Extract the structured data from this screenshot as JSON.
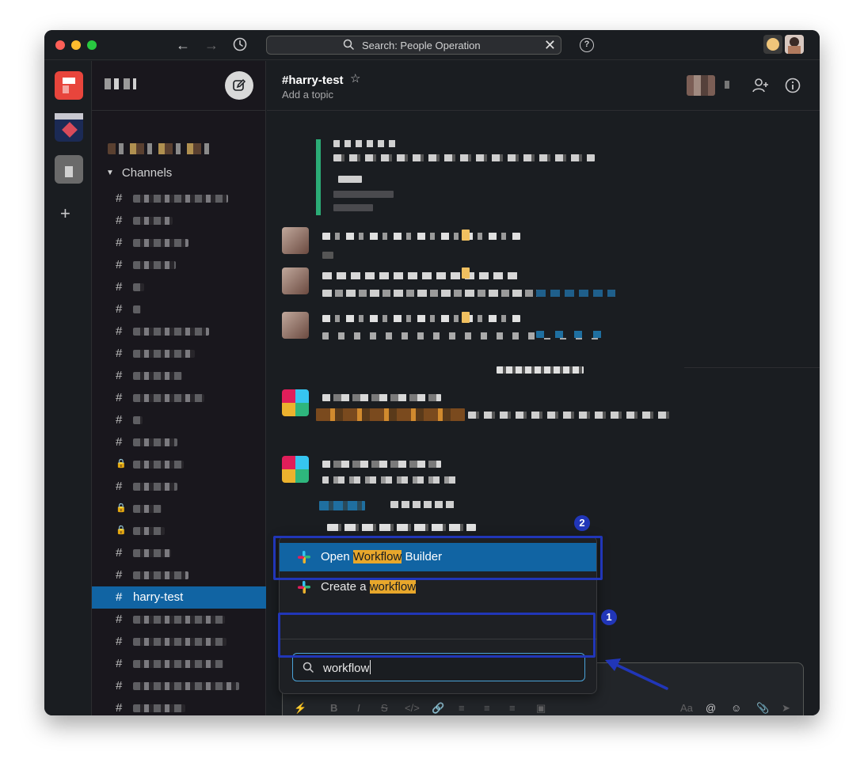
{
  "titlebar": {
    "search_placeholder": "Search: People Operation",
    "back_icon": "arrow-left-icon",
    "forward_icon": "arrow-right-icon",
    "history_icon": "clock-icon",
    "help_label": "?"
  },
  "sidebar": {
    "channels_header": "Channels",
    "active_channel": "harry-test",
    "channel_count": 25
  },
  "channel_header": {
    "title": "#harry-test",
    "topic": "Add a topic"
  },
  "autocomplete": {
    "options": [
      {
        "prefix": "Open ",
        "match": "Workflow",
        "suffix": " Builder"
      },
      {
        "prefix": "Create a ",
        "match": "workflow",
        "suffix": ""
      }
    ],
    "query": "workflow"
  },
  "annotations": {
    "step1": "1",
    "step2": "2"
  },
  "colors": {
    "accent_blue": "#1164a3",
    "annotation_blue": "#2136b8",
    "highlight": "#e8a72b",
    "brand_green": "#2bac76"
  }
}
